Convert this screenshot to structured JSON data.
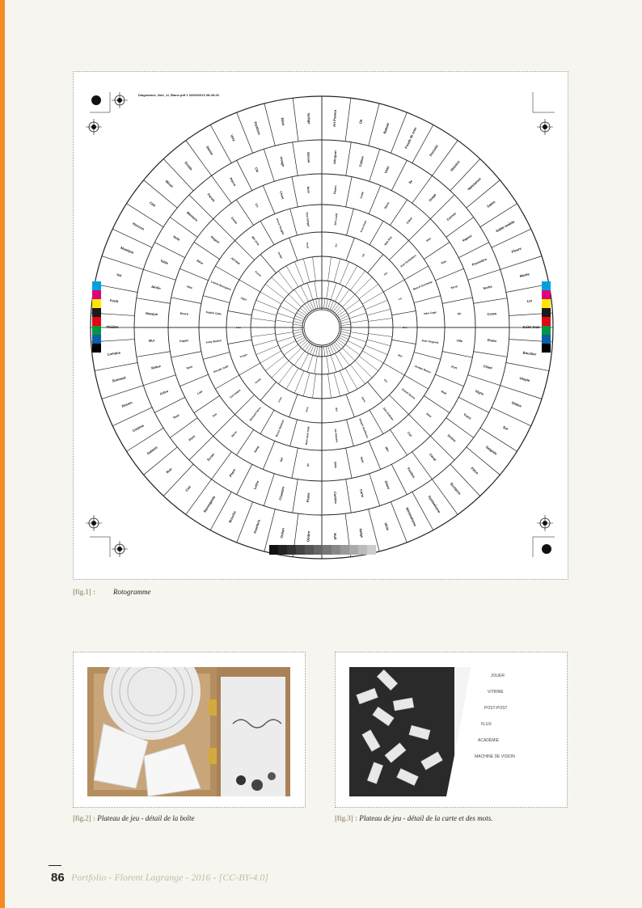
{
  "fig1": {
    "header": "Diagramme_Noir_et_Blanc.pdf 1 02/05/2013 08:49:26",
    "caption_label": "[fig.1] :",
    "caption_title": "Rotogramme",
    "calibration_colors": [
      "#00a0e0",
      "#e0007a",
      "#ffe600",
      "#1a1a1a",
      "#e30613",
      "#009640",
      "#0a5fa8",
      "#000000"
    ],
    "gray_steps": [
      "#111111",
      "#222222",
      "#333333",
      "#444444",
      "#555555",
      "#666666",
      "#777777",
      "#888888",
      "#999999",
      "#aaaaaa",
      "#bbbbbb",
      "#cccccc"
    ],
    "outer_ring": [
      "Art Povera",
      "Oil",
      "Bateau",
      "Fonds de cran",
      "Pressée",
      "Histoire",
      "Naissance",
      "Salon",
      "Sable mobile",
      "Fleurs",
      "Marée",
      "Lin",
      "Saint-Jean",
      "Bouclier",
      "Utopie",
      "Statue",
      "Sol",
      "Saignée",
      "Pièce",
      "Scorpion",
      "Symbolisme",
      "Minimalisme",
      "Idole",
      "Neige",
      "Nuit",
      "Ombre",
      "Océan",
      "Aventure",
      "Bouche",
      "Sauvegarde",
      "Ciel",
      "Rue",
      "Galaxie",
      "Cinéma",
      "Dessin",
      "Sommeil",
      "Lumière",
      "Théâtre",
      "Forêt",
      "Vol",
      "Musique",
      "Horizon",
      "Cité",
      "Miroir",
      "Grotte",
      "Danse",
      "Voix",
      "Partition",
      "Rêve",
      "Vertige"
    ],
    "ring2": [
      "Aéroport",
      "Cabine",
      "Volet",
      "Île",
      "Orage",
      "Cornes",
      "Vapeur",
      "Poussière",
      "Sortie",
      "Corps",
      "Photo",
      "Chant",
      "Signe",
      "Trace",
      "Sirène",
      "Canal",
      "Fenêtre",
      "Dôme",
      "Carte",
      "Caméra",
      "Plume",
      "Chambre",
      "Lettre",
      "Phare",
      "Écran",
      "Pont",
      "Tour",
      "Arbre",
      "Statue",
      "Mur",
      "Masque",
      "Jardin",
      "Table",
      "Voile",
      "Mémoire",
      "Parole",
      "Pierre",
      "Clé",
      "Visage",
      "Oiseau"
    ],
    "ring3": [
      "Fleurs",
      "Lune",
      "Rose",
      "Cœur",
      "Feu",
      "Eau",
      "Terre",
      "Air",
      "Ville",
      "Port",
      "Nuit",
      "Jour",
      "Ciel",
      "Mer",
      "Vent",
      "Bois",
      "Or",
      "Sel",
      "Sang",
      "Verre",
      "Fer",
      "Lait",
      "Soie",
      "Papier",
      "Encre",
      "Voix",
      "Rêve",
      "Regard",
      "Geste",
      "Cri",
      "Chant",
      "Nom"
    ],
    "ring4": [
      "Sol Lewitt",
      "Yves Klein",
      "Man Ray",
      "Kurt Schwitters",
      "Marcel Duchamp",
      "John Cage",
      "Jean Tinguely",
      "Joseph Beuys",
      "Daniel Buren",
      "Dan Graham",
      "Robert Smithson",
      "On Kawara",
      "Nam June Paik",
      "Bruce Nauman",
      "Richard Serra",
      "Carl Andre",
      "Donald Judd",
      "Andy Warhol",
      "Sophie Calle",
      "Louise Bourgeois",
      "Jeff Wall",
      "Bill Viola",
      "Pierre Huyghe",
      "Tino Sehgal"
    ],
    "ring5": [
      "Art",
      "Vie",
      "Jeu",
      "Loi",
      "Son",
      "Mot",
      "Fin",
      "Sens",
      "Œil",
      "Film",
      "Livre",
      "Corps",
      "Temps",
      "Lieu",
      "Objet",
      "Forme",
      "Image",
      "Texte"
    ]
  },
  "fig2": {
    "caption_label": "[fig.2] :",
    "caption_title": "Plateau de jeu - détail de la boîte"
  },
  "fig3": {
    "caption_label": "[fig.3] :",
    "caption_title": "Plateau de jeu - détail de la carte et des mots.",
    "card_words": [
      "JOUER",
      "VITRINE",
      "POST-POST",
      "FLUX",
      "ACADÉMIE",
      "MACHINE DE VISION"
    ]
  },
  "footer": {
    "page_number": "86",
    "text": "Portfolio - Florent Lagrange - 2016 - [CC-BY-4.0]"
  },
  "colors": {
    "accent_orange": "#f28b21",
    "caption_label": "#a89f86",
    "footer_text": "#c3bda6"
  }
}
